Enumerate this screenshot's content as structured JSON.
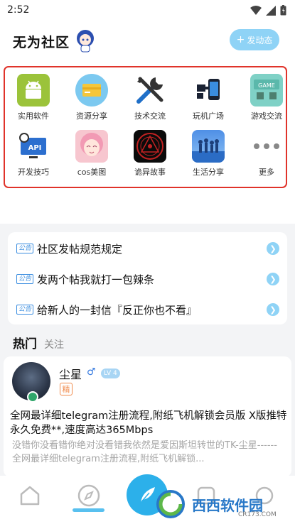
{
  "status_bar": {
    "time": "2:52"
  },
  "header": {
    "title": "无为社区",
    "post_button": "发动态"
  },
  "categories": [
    {
      "label": "实用软件",
      "icon": "android-icon"
    },
    {
      "label": "资源分享",
      "icon": "folder-icon"
    },
    {
      "label": "技术交流",
      "icon": "tools-icon"
    },
    {
      "label": "玩机广场",
      "icon": "phone-icon"
    },
    {
      "label": "游戏交流",
      "icon": "game-icon"
    },
    {
      "label": "开发技巧",
      "icon": "api-icon"
    },
    {
      "label": "cos美图",
      "icon": "anime-girl-icon"
    },
    {
      "label": "诡异故事",
      "icon": "occult-seal-icon"
    },
    {
      "label": "生活分享",
      "icon": "life-photo-icon"
    },
    {
      "label": "更多",
      "icon": "more-icon"
    }
  ],
  "notices": [
    {
      "tag": "公告",
      "text": "社区发帖规范规定"
    },
    {
      "tag": "公告",
      "text": "发两个帖我就打一包辣条"
    },
    {
      "tag": "公告",
      "text": "给新人的一封信『反正你也不看』"
    }
  ],
  "tabs": {
    "hot": "热门",
    "follow": "关注"
  },
  "post": {
    "username": "尘星",
    "gender": "♂",
    "level": "LV 4",
    "essence": "精",
    "title": "全网最详细telegram注册流程,附纸飞机解锁会员版 X版推特 永久免费**,速度高达365Mbps",
    "excerpt": "没错你没看错你绝对没看错我依然是爱因斯坦转世的TK-尘星------全网最详细telegram注册流程,附纸飞机解锁..."
  },
  "watermark": {
    "text": "西西软件园",
    "sub": "CR173.COM"
  },
  "colors": {
    "accent": "#2cb0ea",
    "highlight_box": "#e0332a",
    "light_blue": "#8fd3f6"
  }
}
